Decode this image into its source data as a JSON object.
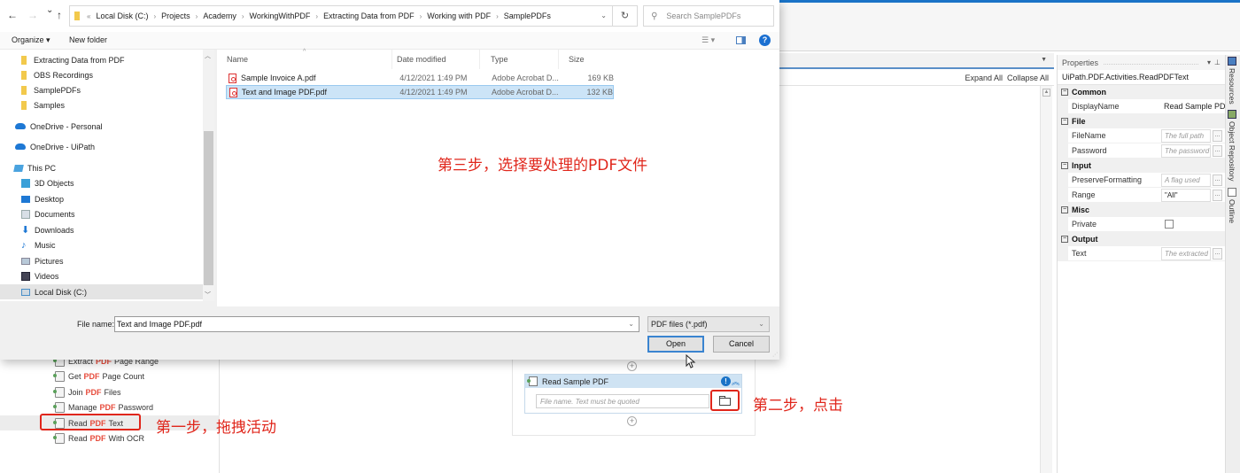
{
  "dialog": {
    "nav": {
      "back": "←",
      "forward": "→",
      "recent": "⌄",
      "up": "↑"
    },
    "breadcrumb": {
      "overflow": "«",
      "parts": [
        "Local Disk (C:)",
        "Projects",
        "Academy",
        "WorkingWithPDF",
        "Extracting Data from PDF",
        "Working with PDF",
        "SamplePDFs"
      ],
      "separator": "›"
    },
    "refresh_icon": "↻",
    "search_placeholder": "Search SamplePDFs",
    "toolbar": {
      "organize": "Organize ▾",
      "new_folder": "New folder",
      "view_icon": "☰ ▾",
      "help_icon": "?"
    },
    "nav_pane": [
      {
        "label": "Extracting Data from PDF",
        "icon": "folder"
      },
      {
        "label": "OBS Recordings",
        "icon": "folder"
      },
      {
        "label": "SamplePDFs",
        "icon": "folder"
      },
      {
        "label": "Samples",
        "icon": "folder"
      },
      {
        "label": "OneDrive - Personal",
        "icon": "cloud"
      },
      {
        "label": "OneDrive - UiPath",
        "icon": "cloud"
      },
      {
        "label": "This PC",
        "icon": "pc"
      },
      {
        "label": "3D Objects",
        "icon": "cube"
      },
      {
        "label": "Desktop",
        "icon": "desktop"
      },
      {
        "label": "Documents",
        "icon": "docs"
      },
      {
        "label": "Downloads",
        "icon": "down"
      },
      {
        "label": "Music",
        "icon": "music"
      },
      {
        "label": "Pictures",
        "icon": "pictures"
      },
      {
        "label": "Videos",
        "icon": "videos"
      },
      {
        "label": "Local Disk (C:)",
        "icon": "disk",
        "selected": true
      }
    ],
    "columns": {
      "name": "Name",
      "date": "Date modified",
      "type": "Type",
      "size": "Size"
    },
    "files": [
      {
        "name": "Sample Invoice A.pdf",
        "date": "4/12/2021 1:49 PM",
        "type": "Adobe Acrobat D...",
        "size": "169 KB",
        "selected": false
      },
      {
        "name": "Text and Image PDF.pdf",
        "date": "4/12/2021 1:49 PM",
        "type": "Adobe Acrobat D...",
        "size": "132 KB",
        "selected": true
      }
    ],
    "file_name_label": "File name:",
    "file_name_value": "Text and Image PDF.pdf",
    "file_type_filter": "PDF files (*.pdf)",
    "open_label": "Open",
    "cancel_label": "Cancel"
  },
  "studio": {
    "designer": {
      "expand_all": "Expand All",
      "collapse_all": "Collapse All"
    },
    "activities": [
      {
        "pre": "Extract",
        "hl": "PDF",
        "post": "Page Range"
      },
      {
        "pre": "Get",
        "hl": "PDF",
        "post": "Page Count"
      },
      {
        "pre": "Join",
        "hl": "PDF",
        "post": "Files"
      },
      {
        "pre": "Manage",
        "hl": "PDF",
        "post": "Password"
      },
      {
        "pre": "Read",
        "hl": "PDF",
        "post": "Text",
        "selected": true
      },
      {
        "pre": "Read",
        "hl": "PDF",
        "post": "With OCR"
      }
    ],
    "activity_card": {
      "title": "Read Sample PDF",
      "filename_placeholder": "File name. Text must be quoted",
      "info_icon": "!",
      "collapse_icon": "≈"
    },
    "properties": {
      "title": "Properties",
      "type_name": "UiPath.PDF.Activities.ReadPDFText",
      "categories": [
        {
          "name": "Common",
          "rows": [
            {
              "name": "DisplayName",
              "value": "Read Sample PDF",
              "kind": "plain"
            }
          ]
        },
        {
          "name": "File",
          "rows": [
            {
              "name": "FileName",
              "value": "The full path",
              "kind": "placeholder"
            },
            {
              "name": "Password",
              "value": "The password",
              "kind": "placeholder"
            }
          ]
        },
        {
          "name": "Input",
          "rows": [
            {
              "name": "PreserveFormatting",
              "value": "A flag used",
              "kind": "placeholder"
            },
            {
              "name": "Range",
              "value": "\"All\"",
              "kind": "value"
            }
          ]
        },
        {
          "name": "Misc",
          "rows": [
            {
              "name": "Private",
              "value": "",
              "kind": "checkbox"
            }
          ]
        },
        {
          "name": "Output",
          "rows": [
            {
              "name": "Text",
              "value": "The extracted",
              "kind": "placeholder"
            }
          ]
        }
      ]
    },
    "side_tabs": [
      "Resources",
      "Object Repository",
      "Outline"
    ]
  },
  "annotations": {
    "step1": "第一步，拖拽活动",
    "step2": "第二步，点击",
    "step3": "第三步，选择要处理的PDF文件",
    "color": "#e0261b"
  }
}
